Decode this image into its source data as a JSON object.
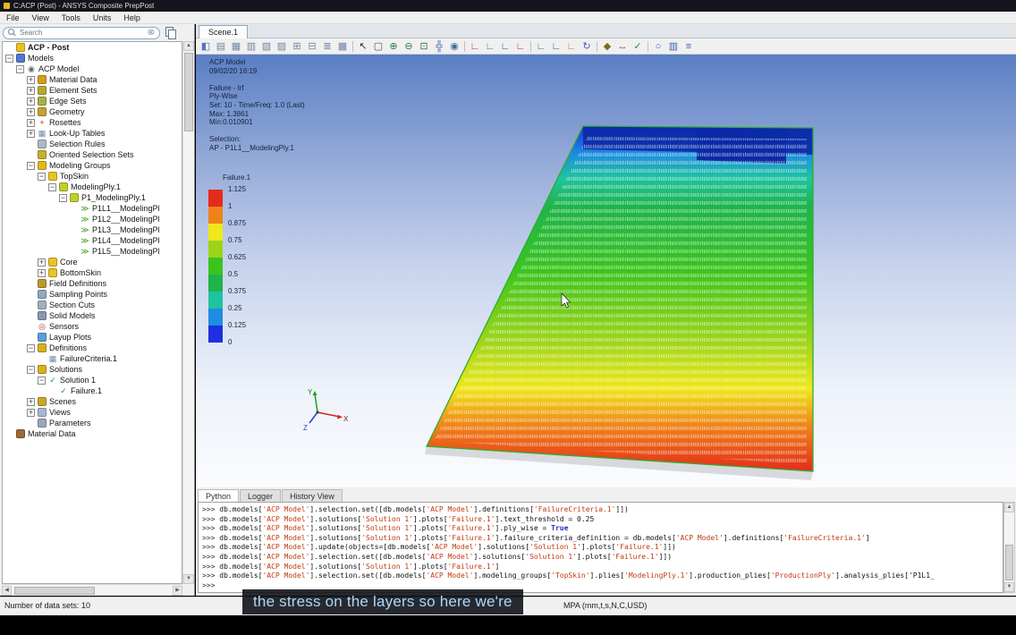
{
  "window": {
    "title": "C:ACP (Post) - ANSYS Composite PrepPost"
  },
  "menu": {
    "items": [
      "File",
      "View",
      "Tools",
      "Units",
      "Help"
    ]
  },
  "search": {
    "placeholder": "Search"
  },
  "main": {
    "scene_tab": "Scene.1"
  },
  "toolbar": {
    "icons": [
      {
        "n": "pin-panel-icon",
        "g": "◧",
        "c": "#4f74c8"
      },
      {
        "n": "new-table-icon",
        "g": "▤",
        "c": "#6f87a8"
      },
      {
        "n": "table-grid-icon",
        "g": "▦",
        "c": "#6f87a8"
      },
      {
        "n": "table-columns-icon",
        "g": "▥",
        "c": "#6f87a8"
      },
      {
        "n": "layer-stack-icon",
        "g": "▧",
        "c": "#6f87a8"
      },
      {
        "n": "matrix-icon",
        "g": "▨",
        "c": "#6f87a8"
      },
      {
        "n": "grid-add-icon",
        "g": "⊞",
        "c": "#6f87a8"
      },
      {
        "n": "grid-remove-icon",
        "g": "⊟",
        "c": "#6f87a8"
      },
      {
        "n": "list-view-icon",
        "g": "≣",
        "c": "#6f87a8"
      },
      {
        "n": "report-icon",
        "g": "▩",
        "c": "#6f87a8"
      },
      {
        "sep": true
      },
      {
        "n": "select-arrow-icon",
        "g": "↖",
        "c": "#303030"
      },
      {
        "n": "box-select-icon",
        "g": "▢",
        "c": "#505050"
      },
      {
        "n": "zoom-in-icon",
        "g": "⊕",
        "c": "#2f7a3a"
      },
      {
        "n": "zoom-out-icon",
        "g": "⊖",
        "c": "#2f7a3a"
      },
      {
        "n": "zoom-box-icon",
        "g": "⊡",
        "c": "#2f7a3a"
      },
      {
        "n": "fit-view-icon",
        "g": "╬",
        "c": "#3a62b8"
      },
      {
        "n": "snapshot-camera-icon",
        "g": "◉",
        "c": "#3a6ea0"
      },
      {
        "sep": true
      },
      {
        "n": "view-front-icon",
        "g": "∟",
        "c": "#c03028"
      },
      {
        "n": "view-back-icon",
        "g": "∟",
        "c": "#2f8a2f"
      },
      {
        "n": "view-left-icon",
        "g": "∟",
        "c": "#3050c0"
      },
      {
        "n": "view-right-icon",
        "g": "∟",
        "c": "#c03028"
      },
      {
        "sep": true
      },
      {
        "n": "view-top-icon",
        "g": "∟",
        "c": "#2f8a2f"
      },
      {
        "n": "view-bottom-icon",
        "g": "∟",
        "c": "#3050c0"
      },
      {
        "n": "view-iso-icon",
        "g": "∟",
        "c": "#c07820"
      },
      {
        "n": "rotate-view-icon",
        "g": "↻",
        "c": "#3a62b8"
      },
      {
        "sep": true
      },
      {
        "n": "lock-view-icon",
        "g": "◆",
        "c": "#806820"
      },
      {
        "n": "measure-icon",
        "g": "↔",
        "c": "#606060"
      },
      {
        "n": "probe-values-icon",
        "g": "✓",
        "c": "#2f8a2f"
      },
      {
        "sep": true
      },
      {
        "n": "search-model-icon",
        "g": "○",
        "c": "#3a62b8"
      },
      {
        "n": "legend-toggle-icon",
        "g": "▥",
        "c": "#3a62b8"
      },
      {
        "n": "annotation-toggle-icon",
        "g": "≡",
        "c": "#3a62b8"
      }
    ]
  },
  "tree": {
    "items": [
      {
        "label": "ACP - Post",
        "d": 0,
        "e": "",
        "bold": true,
        "icon": {
          "ic": "sw",
          "c": "#f0c020"
        }
      },
      {
        "label": "Models",
        "d": 0,
        "e": "-",
        "icon": {
          "ic": "sw",
          "c": "#5078d0"
        }
      },
      {
        "label": "ACP Model",
        "d": 1,
        "e": "-",
        "icon": {
          "ic": "g",
          "g": "◉",
          "c": "#5a6a7a"
        }
      },
      {
        "label": "Material Data",
        "d": 2,
        "e": "+",
        "icon": {
          "ic": "sw",
          "c": "#d0a020"
        }
      },
      {
        "label": "Element Sets",
        "d": 2,
        "e": "+",
        "icon": {
          "ic": "sw",
          "c": "#b8a838"
        }
      },
      {
        "label": "Edge Sets",
        "d": 2,
        "e": "+",
        "icon": {
          "ic": "sw",
          "c": "#a8b048"
        }
      },
      {
        "label": "Geometry",
        "d": 2,
        "e": "+",
        "icon": {
          "ic": "sw",
          "c": "#c8a030"
        }
      },
      {
        "label": "Rosettes",
        "d": 2,
        "e": "+",
        "icon": {
          "ic": "g",
          "g": "+",
          "c": "#c03028"
        }
      },
      {
        "label": "Look-Up Tables",
        "d": 2,
        "e": "+",
        "icon": {
          "ic": "g",
          "g": "▦",
          "c": "#7088a8"
        }
      },
      {
        "label": "Selection Rules",
        "d": 2,
        "e": "",
        "icon": {
          "ic": "sw",
          "c": "#b0b8c0"
        }
      },
      {
        "label": "Oriented Selection Sets",
        "d": 2,
        "e": "",
        "icon": {
          "ic": "sw",
          "c": "#c8b028"
        }
      },
      {
        "label": "Modeling Groups",
        "d": 2,
        "e": "-",
        "icon": {
          "ic": "sw",
          "c": "#e0b818"
        }
      },
      {
        "label": "TopSkin",
        "d": 3,
        "e": "-",
        "icon": {
          "ic": "sw",
          "c": "#e8c428"
        }
      },
      {
        "label": "ModelingPly.1",
        "d": 4,
        "e": "-",
        "icon": {
          "ic": "sw",
          "c": "#c0d028"
        }
      },
      {
        "label": "P1_ModelingPly.1",
        "d": 5,
        "e": "-",
        "icon": {
          "ic": "sw",
          "c": "#c0d028"
        }
      },
      {
        "label": "P1L1__ModelingPl",
        "d": 6,
        "e": "",
        "icon": {
          "ic": "g",
          "g": "≫",
          "c": "#38a018"
        }
      },
      {
        "label": "P1L2__ModelingPl",
        "d": 6,
        "e": "",
        "icon": {
          "ic": "g",
          "g": "≫",
          "c": "#38a018"
        }
      },
      {
        "label": "P1L3__ModelingPl",
        "d": 6,
        "e": "",
        "icon": {
          "ic": "g",
          "g": "≫",
          "c": "#38a018"
        }
      },
      {
        "label": "P1L4__ModelingPl",
        "d": 6,
        "e": "",
        "icon": {
          "ic": "g",
          "g": "≫",
          "c": "#38a018"
        }
      },
      {
        "label": "P1L5__ModelingPl",
        "d": 6,
        "e": "",
        "icon": {
          "ic": "g",
          "g": "≫",
          "c": "#38a018"
        }
      },
      {
        "label": "Core",
        "d": 3,
        "e": "+",
        "icon": {
          "ic": "sw",
          "c": "#e8c428"
        }
      },
      {
        "label": "BottomSkin",
        "d": 3,
        "e": "+",
        "icon": {
          "ic": "sw",
          "c": "#e8c428"
        }
      },
      {
        "label": "Field Definitions",
        "d": 2,
        "e": "",
        "icon": {
          "ic": "sw",
          "c": "#c09830"
        }
      },
      {
        "label": "Sampling Points",
        "d": 2,
        "e": "",
        "icon": {
          "ic": "sw",
          "c": "#90a8c0"
        }
      },
      {
        "label": "Section Cuts",
        "d": 2,
        "e": "",
        "icon": {
          "ic": "sw",
          "c": "#a0b0c0"
        }
      },
      {
        "label": "Solid Models",
        "d": 2,
        "e": "",
        "icon": {
          "ic": "sw",
          "c": "#8898b0"
        }
      },
      {
        "label": "Sensors",
        "d": 2,
        "e": "",
        "icon": {
          "ic": "g",
          "g": "◎",
          "c": "#b03030"
        }
      },
      {
        "label": "Layup Plots",
        "d": 2,
        "e": "",
        "icon": {
          "ic": "sw",
          "c": "#58a0d8"
        }
      },
      {
        "label": "Definitions",
        "d": 2,
        "e": "-",
        "icon": {
          "ic": "sw",
          "c": "#d8b020"
        }
      },
      {
        "label": "FailureCriteria.1",
        "d": 3,
        "e": "",
        "icon": {
          "ic": "g",
          "g": "▦",
          "c": "#7088a8"
        }
      },
      {
        "label": "Solutions",
        "d": 2,
        "e": "-",
        "icon": {
          "ic": "sw",
          "c": "#d8b020"
        }
      },
      {
        "label": "Solution 1",
        "d": 3,
        "e": "-",
        "icon": {
          "ic": "g",
          "g": "✓",
          "c": "#18a018"
        }
      },
      {
        "label": "Failure.1",
        "d": 4,
        "e": "",
        "icon": {
          "ic": "g",
          "g": "✓",
          "c": "#18a018"
        }
      },
      {
        "label": "Scenes",
        "d": 2,
        "e": "+",
        "icon": {
          "ic": "sw",
          "c": "#c8a828"
        }
      },
      {
        "label": "Views",
        "d": 2,
        "e": "+",
        "icon": {
          "ic": "sw",
          "c": "#a8b8d0"
        }
      },
      {
        "label": "Parameters",
        "d": 2,
        "e": "",
        "icon": {
          "ic": "sw",
          "c": "#98a8b8"
        }
      },
      {
        "label": "Material Data",
        "d": 0,
        "e": "",
        "icon": {
          "ic": "sw",
          "c": "#a06838"
        }
      }
    ]
  },
  "viewport": {
    "annotation_lines": [
      "ACP Model",
      "09/02/20 16:19",
      "",
      "Failure - Irf",
      "Ply-Wise",
      "Set: 10 - Time/Freq: 1.0 (Last)",
      "Max: 1.3861",
      "Min:0.010901",
      "",
      "Selection:",
      "AP - P1L1__ModelingPly.1"
    ],
    "legend": {
      "title": "Failure.1",
      "labels": [
        "1.125",
        "1",
        "0.875",
        "0.75",
        "0.625",
        "0.5",
        "0.375",
        "0.25",
        "0.125",
        "0"
      ],
      "colors": [
        "#e32c1a",
        "#f0821a",
        "#f0e81a",
        "#9cd41a",
        "#3cc41e",
        "#1eb44c",
        "#1ec4a0",
        "#1e8ce0",
        "#1e2ee0"
      ]
    },
    "plate": {
      "deep_blue": "#0a2aa6",
      "edge_color": "#2fae2f"
    },
    "triad": {
      "x": "X",
      "y": "Y",
      "z": "Z"
    }
  },
  "console": {
    "tabs": [
      "Python",
      "Logger",
      "History View"
    ],
    "active_tab": "Python",
    "prompt": ">>>",
    "lines": [
      "db.models['ACP Model'].selection.set([db.models['ACP Model'].definitions['FailureCriteria.1']])",
      "db.models['ACP Model'].solutions['Solution 1'].plots['Failure.1'].text_threshold = 0.25",
      "db.models['ACP Model'].solutions['Solution 1'].plots['Failure.1'].ply_wise = True",
      "db.models['ACP Model'].solutions['Solution 1'].plots['Failure.1'].failure_criteria_definition = db.models['ACP Model'].definitions['FailureCriteria.1']",
      "db.models['ACP Model'].update(objects=[db.models['ACP Model'].solutions['Solution 1'].plots['Failure.1']])",
      "db.models['ACP Model'].selection.set([db.models['ACP Model'].solutions['Solution 1'].plots['Failure.1']])",
      "db.models['ACP Model'].solutions['Solution 1'].plots['Failure.1']",
      "db.models['ACP Model'].selection.set([db.models['ACP Model'].modeling_groups['TopSkin'].plies['ModelingPly.1'].production_plies['ProductionPly'].analysis_plies['P1L1_",
      ""
    ]
  },
  "statusbar": {
    "left": "Number of data sets: 10",
    "units": "MPA (mm,t,s,N,C,USD)"
  },
  "caption": {
    "text": "the stress on the layers so here we're"
  }
}
